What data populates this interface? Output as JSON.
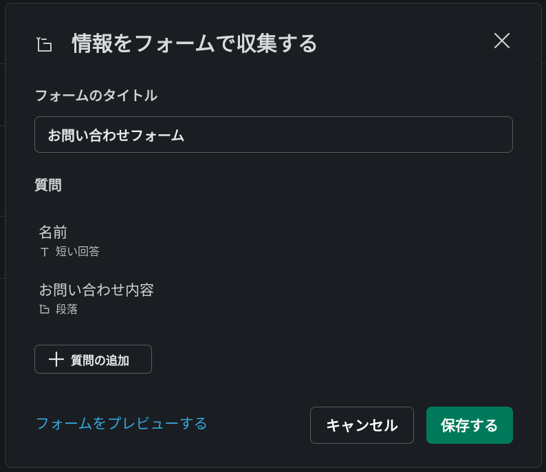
{
  "modal": {
    "title": "情報をフォームで収集する",
    "header_icon": "paragraph-icon",
    "close_icon": "close-icon"
  },
  "form_title": {
    "label": "フォームのタイトル",
    "value": "お問い合わせフォーム"
  },
  "questions": {
    "label": "質問",
    "items": [
      {
        "name": "名前",
        "type_label": "短い回答",
        "type_icon": "text-icon"
      },
      {
        "name": "お問い合わせ内容",
        "type_label": "段落",
        "type_icon": "paragraph-icon"
      }
    ],
    "add_button_label": "質問の追加",
    "add_button_icon": "plus-icon"
  },
  "footer": {
    "preview_link": "フォームをプレビューする",
    "cancel_label": "キャンセル",
    "save_label": "保存する"
  },
  "colors": {
    "modal_bg": "#1a1d21",
    "link": "#36a6dd",
    "primary_button": "#007a5a",
    "border": "#5a5c60"
  }
}
